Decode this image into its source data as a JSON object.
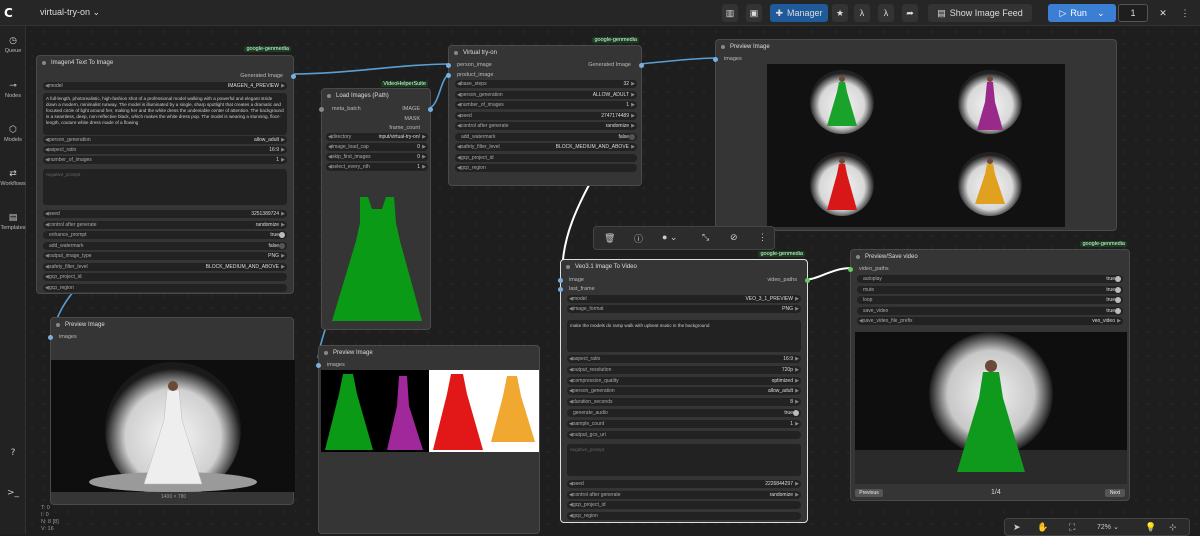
{
  "header": {
    "workflow_title": "virtual-try-on",
    "manager_label": "Manager",
    "show_feed_label": "Show Image Feed",
    "run_label": "Run",
    "run_count": "1"
  },
  "sidebar": [
    {
      "label": "Queue",
      "icon": "history-icon"
    },
    {
      "label": "Nodes",
      "icon": "nodes-icon"
    },
    {
      "label": "Models",
      "icon": "cube-icon"
    },
    {
      "label": "Workflows",
      "icon": "workflow-icon"
    },
    {
      "label": "Templates",
      "icon": "templates-icon"
    }
  ],
  "status": {
    "t": "T: 0",
    "i": "I: 0",
    "n": "N: 8 [8]",
    "v": "V: 16"
  },
  "zoom": "72%",
  "nodes": {
    "imagen": {
      "title": "Imagen4 Text To Image",
      "badge": "google-genmedia",
      "output": "Generated Image",
      "model_label": "model",
      "model": "IMAGEN_4_PREVIEW",
      "prompt": "A full-length, photorealistic, high-fashion shot of a professional model walking with a powerful and elegant stride down a modern, minimalist runway. The model is illuminated by a single, sharp spotlight that creates a dramatic and focused circle of light around her, making her and the white dress the undeniable center of attention. The background is a seamless, deep, non-reflective black, which makes the white dress pop.\n\nThe model is wearing a stunning, floor-length, couture white dress made of a flowing",
      "params": [
        {
          "l": "person_generation",
          "v": "allow_adult"
        },
        {
          "l": "aspect_ratio",
          "v": "16:9"
        },
        {
          "l": "number_of_images",
          "v": "1"
        }
      ],
      "negative": "negative_prompt",
      "params2": [
        {
          "l": "seed",
          "v": "3251389724"
        },
        {
          "l": "control after generate",
          "v": "randomize"
        },
        {
          "l": "enhance_prompt",
          "v": "true"
        },
        {
          "l": "add_watermark",
          "v": "false"
        },
        {
          "l": "output_image_type",
          "v": "PNG"
        },
        {
          "l": "safety_filter_level",
          "v": "BLOCK_MEDIUM_AND_ABOVE"
        },
        {
          "l": "gcp_project_id",
          "v": ""
        },
        {
          "l": "gcp_region",
          "v": ""
        }
      ]
    },
    "load": {
      "title": "Load Images (Path)",
      "badge": "VideoHelperSuite",
      "outputs": [
        "IMAGE",
        "MASK",
        "frame_count"
      ],
      "input": "meta_batch",
      "params": [
        {
          "l": "directory",
          "v": "input/virtual-try-on/"
        },
        {
          "l": "image_load_cap",
          "v": "0"
        },
        {
          "l": "skip_first_images",
          "v": "0"
        },
        {
          "l": "select_every_nth",
          "v": "1"
        }
      ]
    },
    "vto": {
      "title": "Virtual try-on",
      "badge": "google-genmedia",
      "inputs": [
        "person_image",
        "product_image"
      ],
      "output": "Generated Image",
      "params": [
        {
          "l": "base_steps",
          "v": "32"
        },
        {
          "l": "person_generation",
          "v": "ALLOW_ADULT"
        },
        {
          "l": "number_of_images",
          "v": "1"
        },
        {
          "l": "seed",
          "v": "2747174489"
        },
        {
          "l": "control after generate",
          "v": "randomize"
        },
        {
          "l": "add_watermark",
          "v": "false"
        },
        {
          "l": "safety_filter_level",
          "v": "BLOCK_MEDIUM_AND_ABOVE"
        },
        {
          "l": "gcp_project_id",
          "v": ""
        },
        {
          "l": "gcp_region",
          "v": ""
        }
      ]
    },
    "preview1": {
      "title": "Preview Image",
      "input": "images"
    },
    "preview2": {
      "title": "Preview Image",
      "input": "images",
      "caption": "1400 × 780"
    },
    "preview3": {
      "title": "Preview Image",
      "input": "images"
    },
    "veo": {
      "title": "Veo3.1 Image To Video",
      "badge": "google-genmedia",
      "inputs": [
        "image",
        "last_frame"
      ],
      "output": "video_paths",
      "params": [
        {
          "l": "model",
          "v": "VEO_3_1_PREVIEW"
        },
        {
          "l": "image_format",
          "v": "PNG"
        }
      ],
      "prompt": "make the models do ramp walk with upbeat music in the background",
      "params2": [
        {
          "l": "aspect_ratio",
          "v": "16:9"
        },
        {
          "l": "output_resolution",
          "v": "720p"
        },
        {
          "l": "compression_quality",
          "v": "optimized"
        },
        {
          "l": "person_generation",
          "v": "allow_adult"
        },
        {
          "l": "duration_seconds",
          "v": "8"
        },
        {
          "l": "generate_audio",
          "v": "true"
        },
        {
          "l": "sample_count",
          "v": "1"
        },
        {
          "l": "output_gcs_uri",
          "v": ""
        }
      ],
      "negative": "negative_prompt",
      "params3": [
        {
          "l": "seed",
          "v": "2226844297"
        },
        {
          "l": "control after generate",
          "v": "randomize"
        },
        {
          "l": "gcp_project_id",
          "v": ""
        },
        {
          "l": "gcp_region",
          "v": ""
        }
      ]
    },
    "save": {
      "title": "Preview/Save video",
      "badge": "google-genmedia",
      "input": "video_paths",
      "params": [
        {
          "l": "autoplay",
          "v": "true"
        },
        {
          "l": "mute",
          "v": "true"
        },
        {
          "l": "loop",
          "v": "true"
        },
        {
          "l": "save_video",
          "v": "true"
        },
        {
          "l": "save_video_file_prefix",
          "v": "veo_video"
        }
      ],
      "prev": "Previous",
      "next": "Next",
      "counter": "1/4"
    }
  }
}
